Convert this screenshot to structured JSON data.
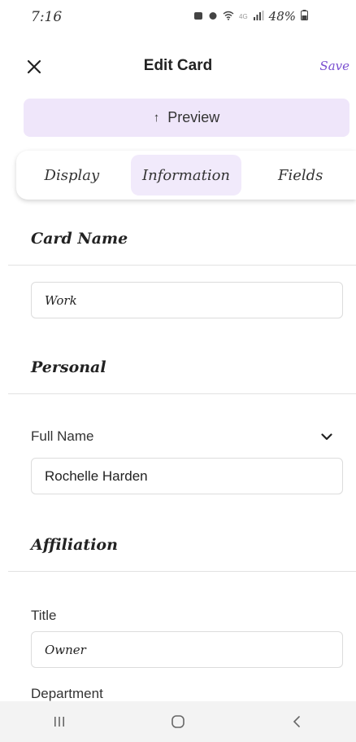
{
  "status_bar": {
    "time": "7:16",
    "battery": "48%",
    "network": "4G"
  },
  "header": {
    "title": "Edit Card",
    "save_label": "Save"
  },
  "preview": {
    "label": "Preview"
  },
  "tabs": [
    {
      "label": "Display",
      "active": false
    },
    {
      "label": "Information",
      "active": true
    },
    {
      "label": "Fields",
      "active": false
    }
  ],
  "sections": {
    "card_name": {
      "title": "Card Name",
      "value": "Work"
    },
    "personal": {
      "title": "Personal",
      "full_name_label": "Full Name",
      "full_name_value": "Rochelle Harden"
    },
    "affiliation": {
      "title": "Affiliation",
      "title_label": "Title",
      "title_value": "Owner",
      "department_label": "Department"
    }
  },
  "colors": {
    "accent": "#7a4fd0",
    "preview_bg": "#efe6fa",
    "active_tab_bg": "#f1eafb"
  }
}
